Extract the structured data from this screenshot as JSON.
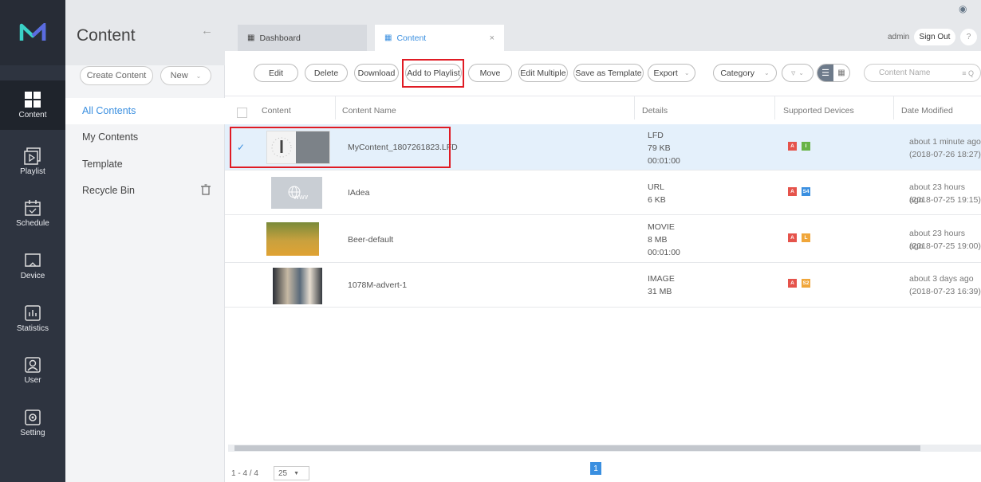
{
  "nav": {
    "items": [
      {
        "label": "Content",
        "icon": "grid-icon"
      },
      {
        "label": "Playlist",
        "icon": "playlist-icon"
      },
      {
        "label": "Schedule",
        "icon": "calendar-icon"
      },
      {
        "label": "Device",
        "icon": "monitor-icon"
      },
      {
        "label": "Statistics",
        "icon": "chart-icon"
      },
      {
        "label": "User",
        "icon": "user-icon"
      },
      {
        "label": "Setting",
        "icon": "gear-icon"
      }
    ]
  },
  "panel": {
    "title": "Content",
    "create_label": "Create Content",
    "new_label": "New",
    "menu": [
      "All Contents",
      "My Contents",
      "Template",
      "Recycle Bin"
    ]
  },
  "tabs": [
    {
      "label": "Dashboard"
    },
    {
      "label": "Content"
    }
  ],
  "account": {
    "user": "admin",
    "sign_out": "Sign Out",
    "help": "?"
  },
  "toolbar": {
    "edit": "Edit",
    "delete": "Delete",
    "download": "Download",
    "add_to_playlist": "Add to Playlist",
    "move": "Move",
    "edit_multiple": "Edit Multiple",
    "save_as_template": "Save as Template",
    "export": "Export",
    "category": "Category",
    "search_placeholder": "Content Name"
  },
  "table": {
    "headers": [
      "Content",
      "Content Name",
      "Details",
      "Supported Devices",
      "Date Modified"
    ],
    "rows": [
      {
        "name": "MyContent_1807261823.LFD",
        "type": "LFD",
        "size": "79 KB",
        "duration": "00:01:00",
        "devices": [
          "A",
          "I"
        ],
        "date1": "about 1 minute ago",
        "date2": "(2018-07-26 18:27)",
        "checked": true
      },
      {
        "name": "IAdea",
        "type": "URL",
        "size": "6 KB",
        "duration": "",
        "devices": [
          "A",
          "S4"
        ],
        "date1": "about 23 hours ago",
        "date2": "(2018-07-25 19:15)",
        "checked": false
      },
      {
        "name": "Beer-default",
        "type": "MOVIE",
        "size": "8 MB",
        "duration": "00:01:00",
        "devices": [
          "A",
          "L"
        ],
        "date1": "about 23 hours ago",
        "date2": "(2018-07-25 19:00)",
        "checked": false
      },
      {
        "name": "1078M-advert-1",
        "type": "IMAGE",
        "size": "31 MB",
        "duration": "",
        "devices": [
          "A",
          "S2"
        ],
        "date1": "about 3 days ago",
        "date2": "(2018-07-23 16:39)",
        "checked": false
      }
    ]
  },
  "pagination": {
    "range": "1 - 4 / 4",
    "per_page": "25",
    "page": "1"
  },
  "colors": {
    "accent": "#3a8fe0",
    "highlight": "#e01b24",
    "row_selected": "#e4f0fb"
  }
}
